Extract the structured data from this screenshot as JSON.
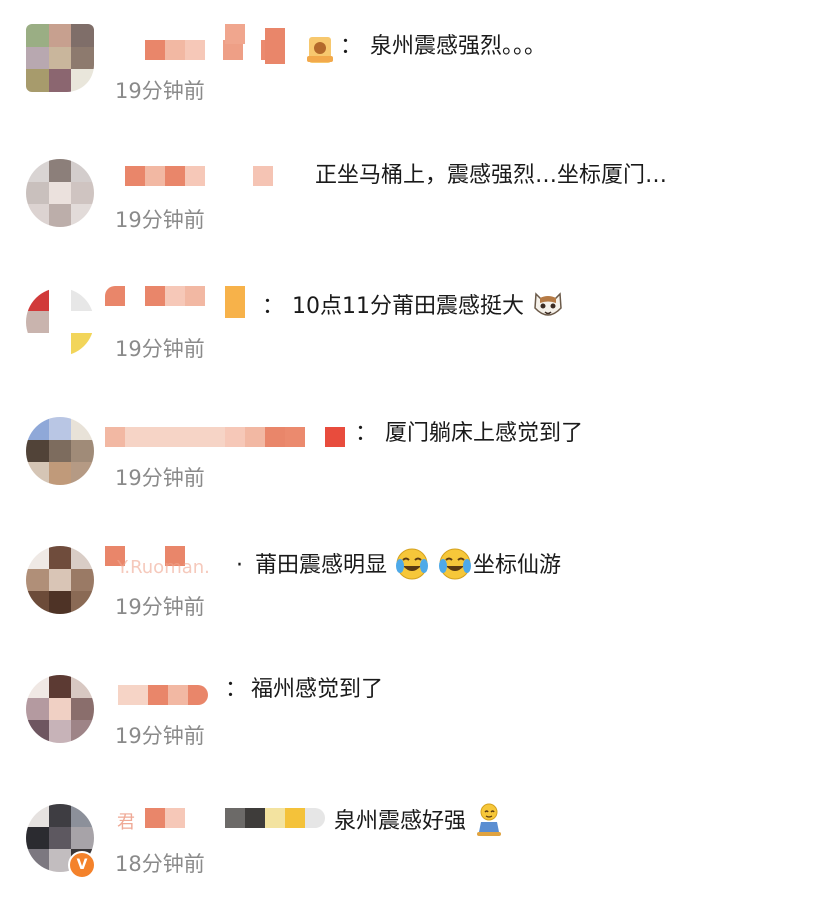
{
  "comments": [
    {
      "text": "泉州震感强烈。。。",
      "time": "19分钟前",
      "separator": "："
    },
    {
      "text": "正坐马桶上，震感强烈…坐标厦门…",
      "time": "19分钟前",
      "separator": ""
    },
    {
      "text": "10点11分莆田震感挺大",
      "time": "19分钟前",
      "separator": "："
    },
    {
      "text": "厦门躺床上感觉到了",
      "time": "19分钟前",
      "separator": "："
    },
    {
      "text_before": "莆田震感明显",
      "text_after": "坐标仙游",
      "time": "19分钟前",
      "separator": "·",
      "faded_username": "Y.Ruoman."
    },
    {
      "text": "福州感觉到了",
      "time": "19分钟前",
      "separator": "："
    },
    {
      "text": "泉州震感好强",
      "time": "18分钟前",
      "separator": "",
      "username_glyph": "君",
      "verified": "V"
    }
  ],
  "icons": {
    "emoji_3": "cat-face-icon",
    "emoji_5": "laughing-tears-icon",
    "emoji_7": "sitting-figure-icon",
    "verified_badge": "verified-v-icon"
  },
  "colors": {
    "text": "#1a1a1a",
    "time": "#8a8a8a",
    "mosaic_orange": "#e9866a",
    "verified": "#f4822b"
  }
}
